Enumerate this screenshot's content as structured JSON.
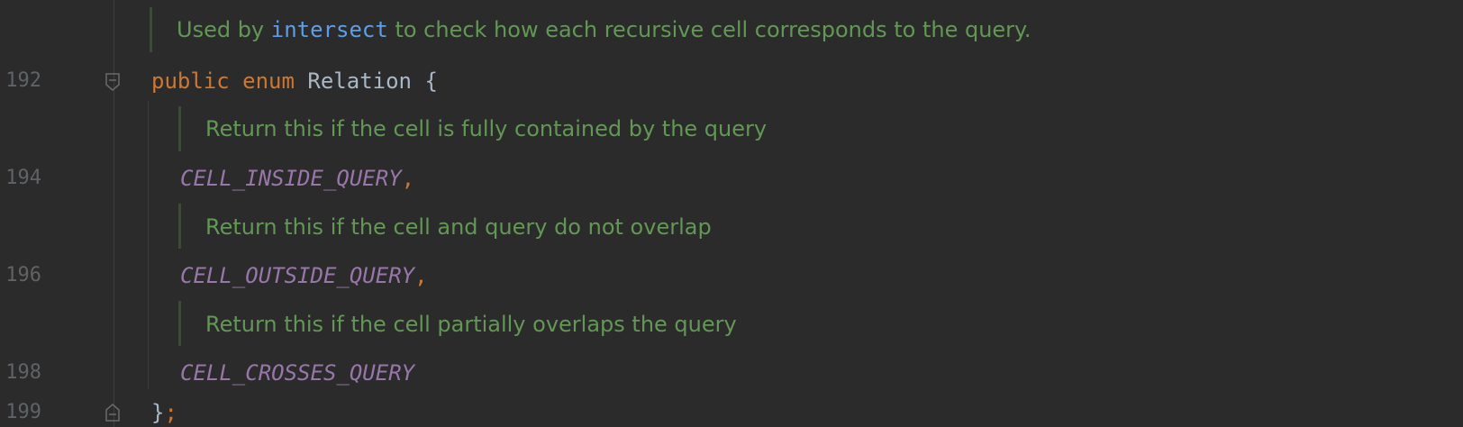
{
  "editor": {
    "doc_top": {
      "prefix": "Used by ",
      "link": "intersect",
      "suffix": " to check how each recursive cell corresponds to the query."
    },
    "line_192": {
      "number": "192",
      "kw_public": "public",
      "kw_enum": "enum",
      "name": "Relation",
      "brace": "{"
    },
    "doc_inside": "Return this if the cell is fully contained by the query",
    "line_194": {
      "number": "194",
      "constant": "CELL_INSIDE_QUERY",
      "comma": ","
    },
    "doc_outside": "Return this if the cell and query do not overlap",
    "line_196": {
      "number": "196",
      "constant": "CELL_OUTSIDE_QUERY",
      "comma": ","
    },
    "doc_crosses": "Return this if the cell partially overlaps the query",
    "line_198": {
      "number": "198",
      "constant": "CELL_CROSSES_QUERY"
    },
    "line_199": {
      "number": "199",
      "brace": "}",
      "semicolon": ";"
    }
  }
}
